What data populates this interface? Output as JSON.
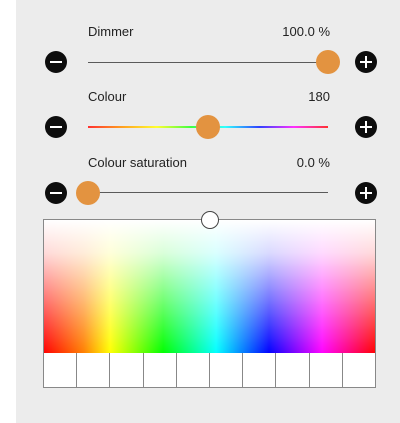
{
  "dimmer": {
    "label": "Dimmer",
    "value_text": "100.0 %",
    "value": 100.0,
    "min": 0,
    "max": 100
  },
  "colour": {
    "label": "Colour",
    "value_text": "180",
    "value": 180,
    "min": 0,
    "max": 360
  },
  "saturation": {
    "label": "Colour saturation",
    "value_text": "0.0 %",
    "value": 0.0,
    "min": 0,
    "max": 100
  },
  "colors": {
    "panel": "#ececec",
    "thumb": "#e39340",
    "button": "#0d0d0d",
    "track": "#5a5a5a"
  },
  "icons": {
    "decrease": "minus-circle-icon",
    "increase": "plus-circle-icon"
  },
  "swatches": [
    "",
    "",
    "",
    "",
    "",
    "",
    "",
    "",
    "",
    ""
  ]
}
